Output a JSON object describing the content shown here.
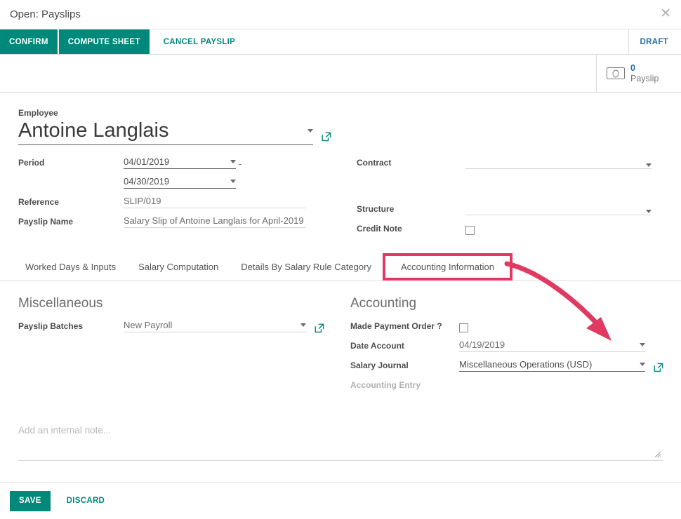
{
  "window": {
    "title": "Open: Payslips",
    "close_icon": "close-icon"
  },
  "control_panel": {
    "buttons": [
      {
        "label": "CONFIRM",
        "style": "primary"
      },
      {
        "label": "COMPUTE SHEET",
        "style": "primary"
      },
      {
        "label": "CANCEL PAYSLIP",
        "style": "link"
      }
    ],
    "status": "DRAFT"
  },
  "stat_buttons": [
    {
      "value": "0",
      "label": "Payslip",
      "icon": "money-icon"
    }
  ],
  "form": {
    "employee": {
      "label": "Employee",
      "value": "Antoine Langlais",
      "external_link_icon": "external-link-icon",
      "dropdown_icon": "chevron-down-icon"
    },
    "left_fields": {
      "period_label": "Period",
      "period_from": "04/01/2019",
      "period_separator": "-",
      "period_to": "04/30/2019",
      "reference_label": "Reference",
      "reference_value": "SLIP/019",
      "payslip_name_label": "Payslip Name",
      "payslip_name_value": "Salary Slip of Antoine Langlais for April-2019"
    },
    "right_fields": {
      "contract_label": "Contract",
      "contract_value": "",
      "structure_label": "Structure",
      "structure_value": "",
      "credit_note_label": "Credit Note",
      "credit_note_checked": false
    }
  },
  "tabs": [
    {
      "label": "Worked Days & Inputs",
      "active": false
    },
    {
      "label": "Salary Computation",
      "active": false
    },
    {
      "label": "Details By Salary Rule Category",
      "active": false
    },
    {
      "label": "Accounting Information",
      "active": true
    }
  ],
  "accounting_tab": {
    "miscellaneous": {
      "title": "Miscellaneous",
      "payslip_batches_label": "Payslip Batches",
      "payslip_batches_value": "New Payroll"
    },
    "accounting": {
      "title": "Accounting",
      "made_payment_order_label": "Made Payment Order ?",
      "made_payment_order_checked": false,
      "date_account_label": "Date Account",
      "date_account_value": "04/19/2019",
      "salary_journal_label": "Salary Journal",
      "salary_journal_value": "Miscellaneous Operations (USD)",
      "accounting_entry_label": "Accounting Entry",
      "accounting_entry_value": ""
    }
  },
  "note": {
    "placeholder": "Add an internal note...",
    "value": ""
  },
  "footer": {
    "save_label": "SAVE",
    "discard_label": "DISCARD"
  },
  "annotation": {
    "highlight_target": "Accounting Information",
    "arrow_color": "#e03a62",
    "highlight_color": "#e03a62"
  },
  "colors": {
    "accent_teal": "#00897b",
    "status_blue": "#1f6faa",
    "annotation_pink": "#e03a62"
  }
}
